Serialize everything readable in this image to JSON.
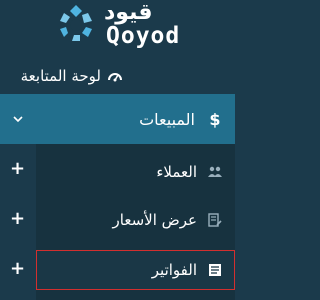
{
  "brand": {
    "name_ar": "قيود",
    "name_en": "Qoyod",
    "colors": {
      "sidebar_bg": "#1b3a4b",
      "active_section": "#226f8d",
      "sub_bg": "#17323f",
      "highlight_border": "#d32f2f"
    }
  },
  "sidebar": {
    "dashboard": {
      "label": "لوحة المتابعة",
      "icon": "dashboard-gauge-icon"
    },
    "sales": {
      "label": "المبيعات",
      "icon": "dollar-icon",
      "expanded": true,
      "toggle_icon": "chevron-down-icon"
    },
    "sales_items": [
      {
        "label": "العملاء",
        "icon": "users-icon",
        "action_icon": "plus-icon"
      },
      {
        "label": "عرض الأسعار",
        "icon": "quote-edit-icon",
        "action_icon": "plus-icon"
      },
      {
        "label": "الفواتير",
        "icon": "invoice-icon",
        "action_icon": "plus-icon",
        "highlighted": true
      }
    ]
  }
}
